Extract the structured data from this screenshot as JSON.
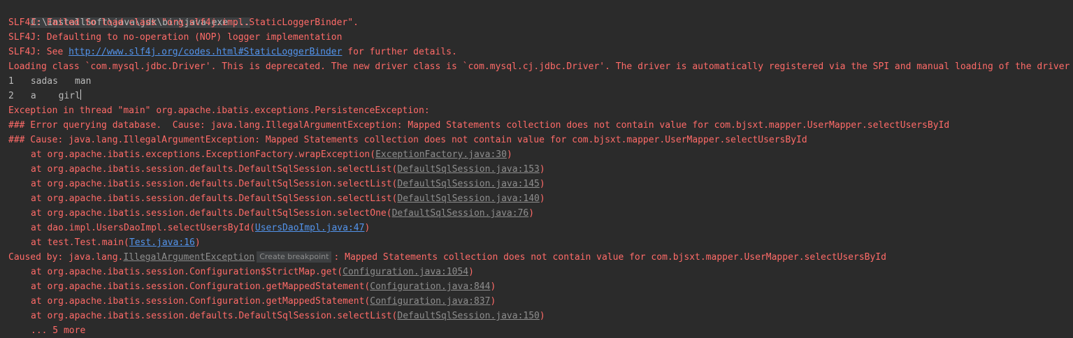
{
  "console": {
    "command": "C:\\InstallSoft\\java\\jdk\\bin\\java.exe ...",
    "slf4j_fail": "SLF4J: Failed to load class \"org.slf4j.impl.StaticLoggerBinder\".",
    "slf4j_default": "SLF4J: Defaulting to no-operation (NOP) logger implementation",
    "slf4j_see_prefix": "SLF4J: See ",
    "slf4j_url": "http://www.slf4j.org/codes.html#StaticLoggerBinder",
    "slf4j_see_suffix": " for further details.",
    "driver_warning": "Loading class `com.mysql.jdbc.Driver'. This is deprecated. The new driver class is `com.mysql.cj.jdbc.Driver'. The driver is automatically registered via the SPI and manual loading of the driver class is generally unnecessary.",
    "rows": [
      {
        "id": "1",
        "name": "sadas",
        "sex": "man"
      },
      {
        "id": "2",
        "name": "a",
        "sex": "girl"
      }
    ],
    "exception_header": "Exception in thread \"main\" org.apache.ibatis.exceptions.PersistenceException: ",
    "error_querying": "### Error querying database.  Cause: java.lang.IllegalArgumentException: Mapped Statements collection does not contain value for com.bjsxt.mapper.UserMapper.selectUsersById",
    "cause_line": "### Cause: java.lang.IllegalArgumentException: Mapped Statements collection does not contain value for com.bjsxt.mapper.UserMapper.selectUsersById",
    "stack1": [
      {
        "method": "at org.apache.ibatis.exceptions.ExceptionFactory.wrapException(",
        "file": "ExceptionFactory.java:30",
        "kind": "lib"
      },
      {
        "method": "at org.apache.ibatis.session.defaults.DefaultSqlSession.selectList(",
        "file": "DefaultSqlSession.java:153",
        "kind": "lib"
      },
      {
        "method": "at org.apache.ibatis.session.defaults.DefaultSqlSession.selectList(",
        "file": "DefaultSqlSession.java:145",
        "kind": "lib"
      },
      {
        "method": "at org.apache.ibatis.session.defaults.DefaultSqlSession.selectList(",
        "file": "DefaultSqlSession.java:140",
        "kind": "lib"
      },
      {
        "method": "at org.apache.ibatis.session.defaults.DefaultSqlSession.selectOne(",
        "file": "DefaultSqlSession.java:76",
        "kind": "lib"
      },
      {
        "method": "at dao.impl.UsersDaoImpl.selectUsersById(",
        "file": "UsersDaoImpl.java:47",
        "kind": "src"
      },
      {
        "method": "at test.Test.main(",
        "file": "Test.java:16",
        "kind": "src"
      }
    ],
    "caused_by_prefix": "Caused by: java.lang.",
    "caused_by_class": "IllegalArgumentException",
    "create_breakpoint": "Create breakpoint",
    "caused_by_suffix": ": Mapped Statements collection does not contain value for com.bjsxt.mapper.UserMapper.selectUsersById",
    "stack2": [
      {
        "method": "at org.apache.ibatis.session.Configuration$StrictMap.get(",
        "file": "Configuration.java:1054",
        "kind": "lib"
      },
      {
        "method": "at org.apache.ibatis.session.Configuration.getMappedStatement(",
        "file": "Configuration.java:844",
        "kind": "lib"
      },
      {
        "method": "at org.apache.ibatis.session.Configuration.getMappedStatement(",
        "file": "Configuration.java:837",
        "kind": "lib"
      },
      {
        "method": "at org.apache.ibatis.session.defaults.DefaultSqlSession.selectList(",
        "file": "DefaultSqlSession.java:150",
        "kind": "lib"
      }
    ],
    "more": "... 5 more",
    "close_paren": ")"
  },
  "colors": {
    "background": "#2b2b2b",
    "error_text": "#ff6b68",
    "normal_text": "#bbbbbb",
    "source_link": "#5394ec",
    "library_link": "#8e8e8e"
  }
}
